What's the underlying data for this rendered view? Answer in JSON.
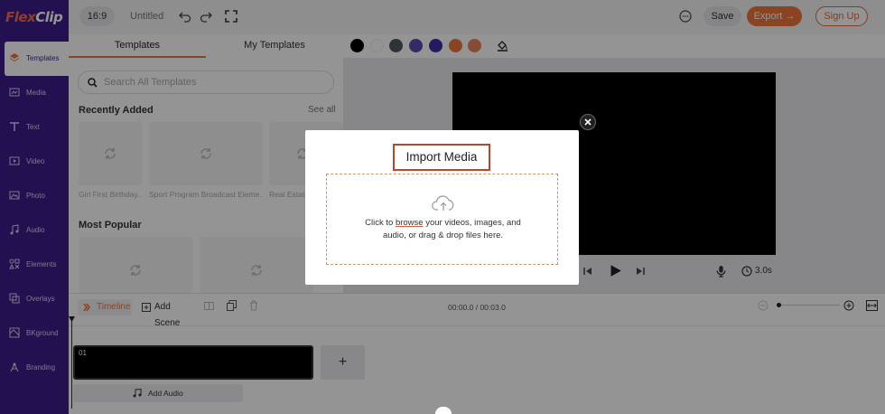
{
  "app": {
    "logo_flex": "Flex",
    "logo_clip": "Clip",
    "accent": "#f0763a",
    "sidebar_color": "#3d1d8a"
  },
  "sidebar": {
    "items": [
      {
        "label": "Templates",
        "icon": "layers-icon"
      },
      {
        "label": "Media",
        "icon": "media-icon"
      },
      {
        "label": "Text",
        "icon": "text-icon"
      },
      {
        "label": "Video",
        "icon": "video-icon"
      },
      {
        "label": "Photo",
        "icon": "photo-icon"
      },
      {
        "label": "Audio",
        "icon": "audio-icon"
      },
      {
        "label": "Elements",
        "icon": "elements-icon"
      },
      {
        "label": "Overlays",
        "icon": "overlays-icon"
      },
      {
        "label": "BKground",
        "icon": "background-icon"
      },
      {
        "label": "Branding",
        "icon": "branding-icon"
      }
    ]
  },
  "topbar": {
    "ratio": "16:9",
    "title": "Untitled",
    "save": "Save",
    "export": "Export →",
    "signup": "Sign Up"
  },
  "panel": {
    "tabs": [
      "Templates",
      "My Templates"
    ],
    "search_placeholder": "Search All Templates",
    "recent_title": "Recently Added",
    "see_all": "See all",
    "recent": [
      "Girl First Birthday...",
      "Sport Program Broadcast Eleme...",
      "Real Estate..."
    ],
    "popular_title": "Most Popular"
  },
  "colorbar": {
    "swatches": [
      "#000000",
      "#ffffff",
      "#505a5c",
      "#5b4bb0",
      "#3d2fa6",
      "#f0763a",
      "#e8845c"
    ]
  },
  "player": {
    "duration": "3.0s"
  },
  "timeline": {
    "label": "Timeline",
    "add_scene": "Add Scene",
    "time": "00:00.0 / 00:03.0",
    "scene_number": "01",
    "add_scene_plus": "+",
    "add_audio": "Add Audio"
  },
  "modal": {
    "title": "Import Media",
    "text_before": "Click to ",
    "browse": "browse",
    "text_after": " your videos, images, and",
    "text_line2": "audio, or drag & drop files here."
  }
}
